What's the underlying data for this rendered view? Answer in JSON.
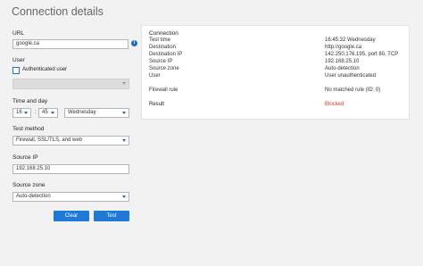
{
  "title": "Connection details",
  "form": {
    "url_label": "URL",
    "url_value": "google.ca",
    "user_label": "User",
    "auth_user_label": "Authenticated user",
    "user_select_value": "",
    "time_label": "Time and day",
    "hour": "16",
    "minute": "45",
    "day": "Wednesday",
    "test_method_label": "Test method",
    "test_method_value": "Firewall, SSL/TLS, and web",
    "source_ip_label": "Source IP",
    "source_ip_value": "192.168.25.10",
    "source_zone_label": "Source zone",
    "source_zone_value": "Auto-detection",
    "clear_label": "Clear",
    "test_label": "Test",
    "info_icon": "i",
    "time_separator": ":"
  },
  "result_panel": {
    "header": "Connection",
    "rows": [
      {
        "key": "Test time",
        "value": "16:45:32 Wednesday"
      },
      {
        "key": "Destination",
        "value": "http://google.ca"
      },
      {
        "key": "Destination IP",
        "value": "142.250.176.195, port 80, TCP"
      },
      {
        "key": "Source IP",
        "value": "192.168.25.10"
      },
      {
        "key": "Source zone",
        "value": "Auto-detection"
      },
      {
        "key": "User",
        "value": "User unauthenticated"
      },
      {
        "key": "Firewall rule",
        "value": "No matched rule (ID: 0)"
      },
      {
        "key": "Result",
        "value": "Blocked"
      }
    ]
  },
  "colors": {
    "accent": "#1f7ad6",
    "blocked": "#d43b2a",
    "background": "#f2f2f2"
  }
}
